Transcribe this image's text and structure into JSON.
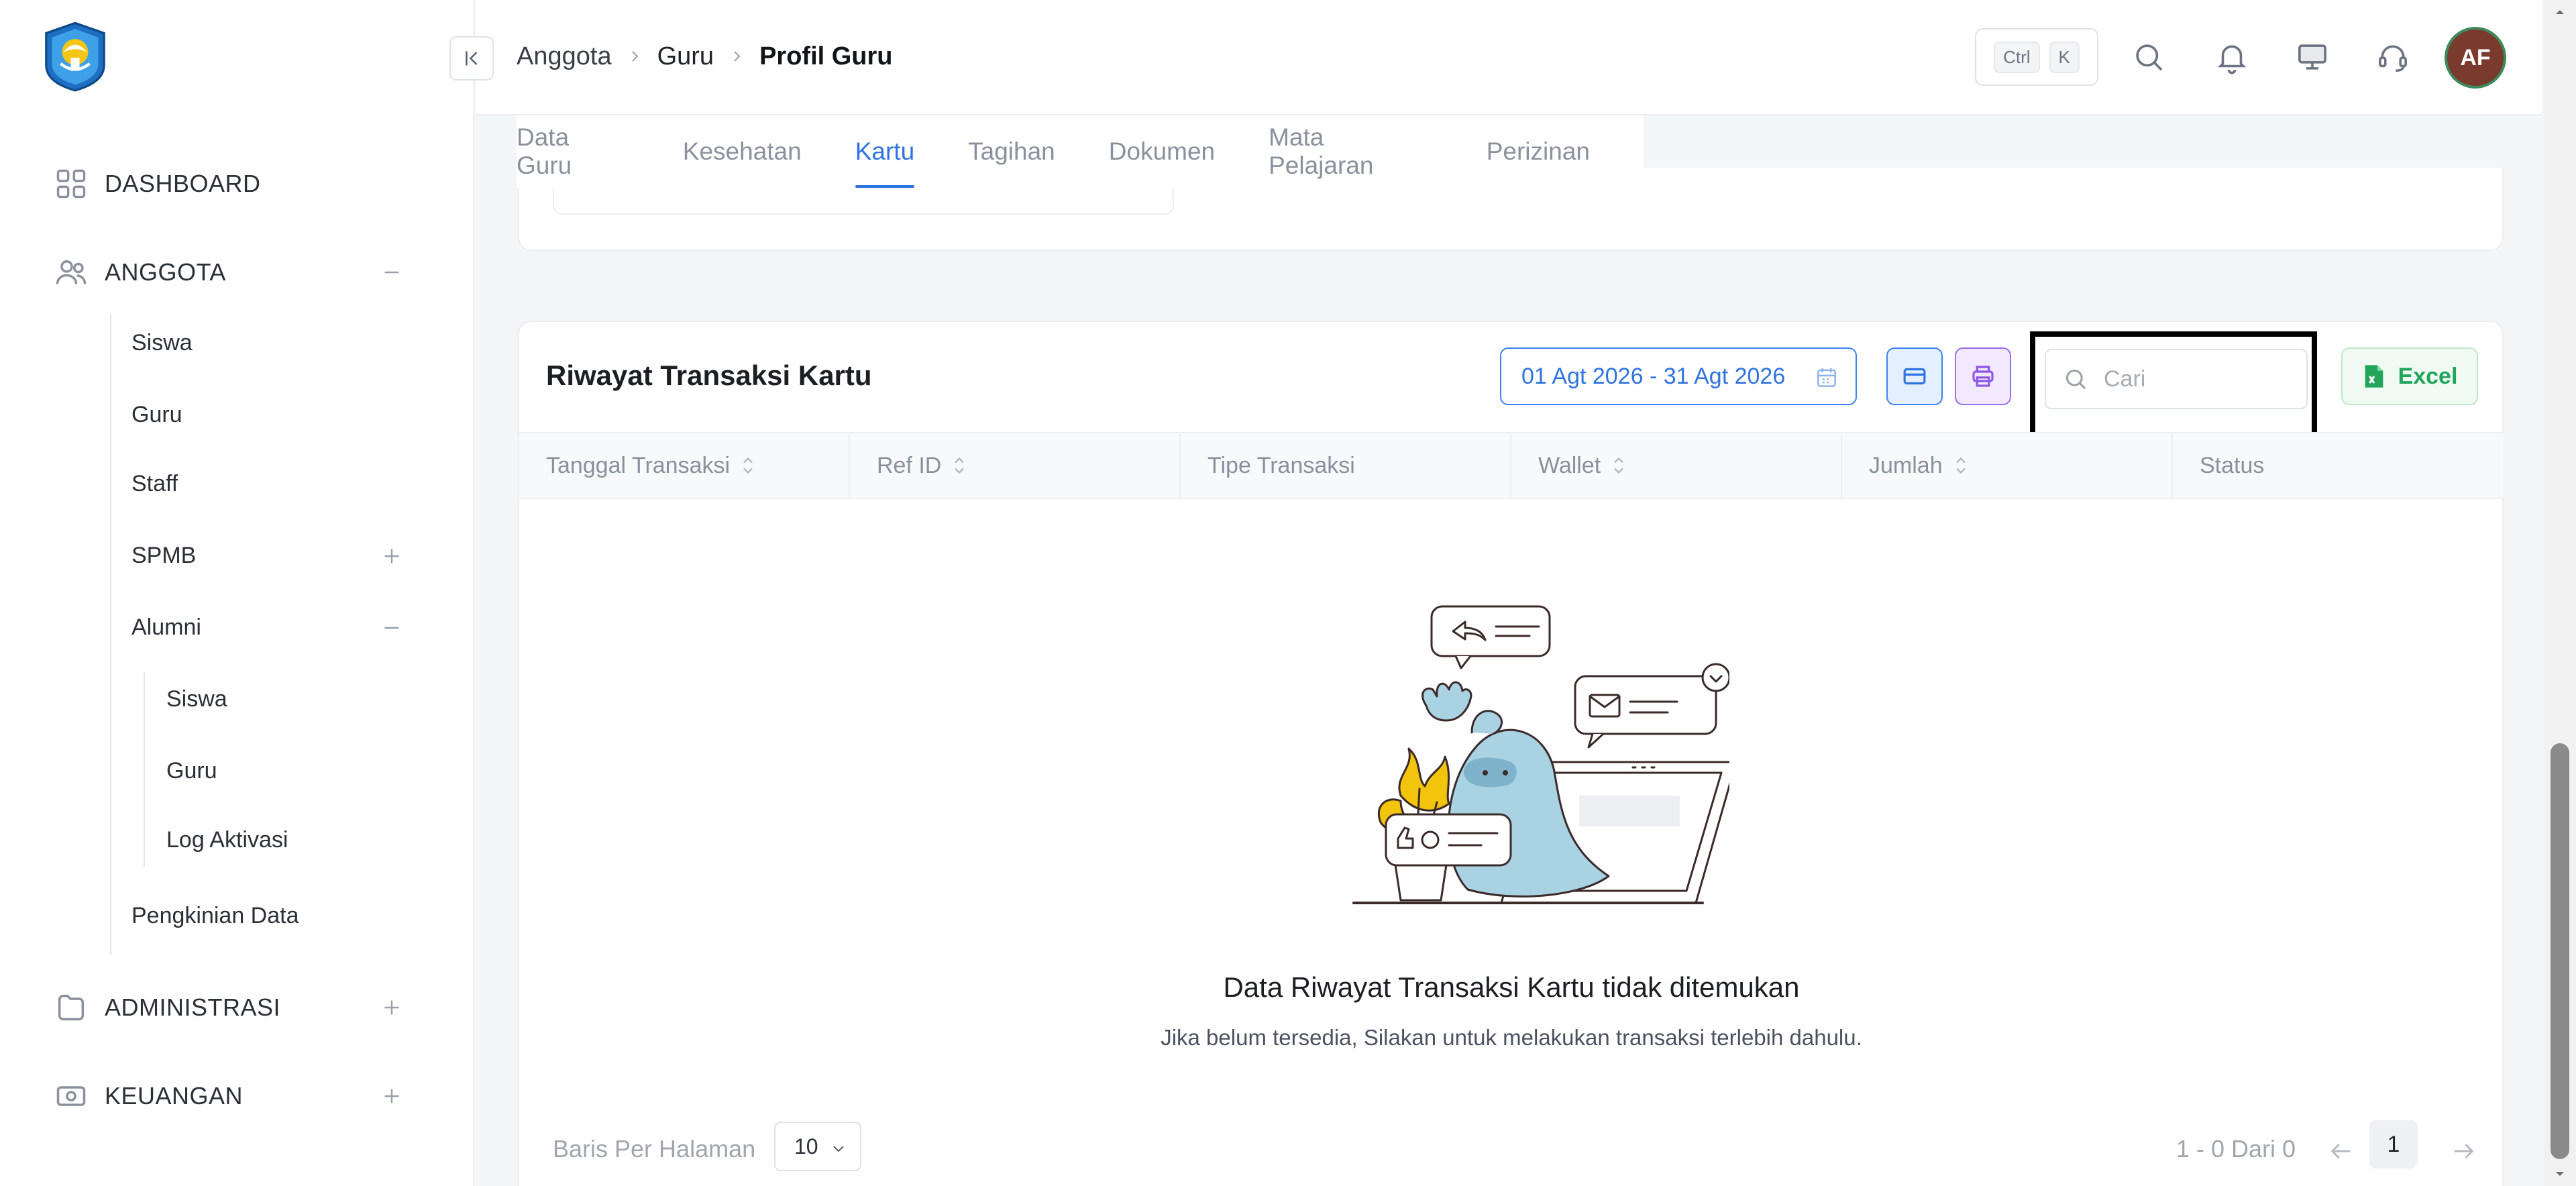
{
  "sidebar": {
    "logo_icon": "tut-wuri-handayani-logo",
    "items": [
      {
        "label": "DASHBOARD",
        "icon": "grid-icon"
      },
      {
        "label": "ANGGOTA",
        "icon": "users-icon",
        "toggle": "minus"
      },
      {
        "label": "ADMINISTRASI",
        "icon": "folder-icon",
        "toggle": "plus"
      },
      {
        "label": "KEUANGAN",
        "icon": "cash-icon",
        "toggle": "plus"
      }
    ],
    "anggota_children": {
      "siswa": "Siswa",
      "guru": "Guru",
      "staff": "Staff",
      "spmb": "SPMB",
      "alumni": "Alumni",
      "alumni_siswa": "Siswa",
      "alumni_guru": "Guru",
      "log_aktivasi": "Log Aktivasi",
      "pengkinian_data": "Pengkinian Data"
    }
  },
  "header": {
    "breadcrumb": [
      "Anggota",
      "Guru",
      "Profil Guru"
    ],
    "shortcut_keys": [
      "Ctrl",
      "K"
    ],
    "avatar_initials": "AF"
  },
  "tabs": [
    {
      "label": "Data Guru",
      "active": false
    },
    {
      "label": "Kesehatan",
      "active": false
    },
    {
      "label": "Kartu",
      "active": true
    },
    {
      "label": "Tagihan",
      "active": false
    },
    {
      "label": "Dokumen",
      "active": false
    },
    {
      "label": "Mata Pelajaran",
      "active": false
    },
    {
      "label": "Perizinan",
      "active": false
    }
  ],
  "transactions": {
    "title": "Riwayat Transaksi Kartu",
    "date_range": "01 Agt 2026 - 31 Agt 2026",
    "search_placeholder": "Cari",
    "excel_label": "Excel",
    "columns": [
      "Tanggal Transaksi",
      "Ref ID",
      "Tipe Transaksi",
      "Wallet",
      "Jumlah",
      "Status"
    ],
    "rows": [],
    "empty_title": "Data Riwayat Transaksi Kartu tidak ditemukan",
    "empty_subtitle": "Jika belum tersedia, Silakan untuk melakukan transaksi terlebih dahulu.",
    "rows_per_page_label": "Baris Per Halaman",
    "rows_per_page": "10",
    "range_text": "1 - 0 Dari 0",
    "current_page": "1"
  },
  "colors": {
    "accent": "#2f73e0",
    "excel_green": "#22a55a",
    "print_purple": "#8a55ea",
    "avatar_bg": "#7a3b2e"
  }
}
